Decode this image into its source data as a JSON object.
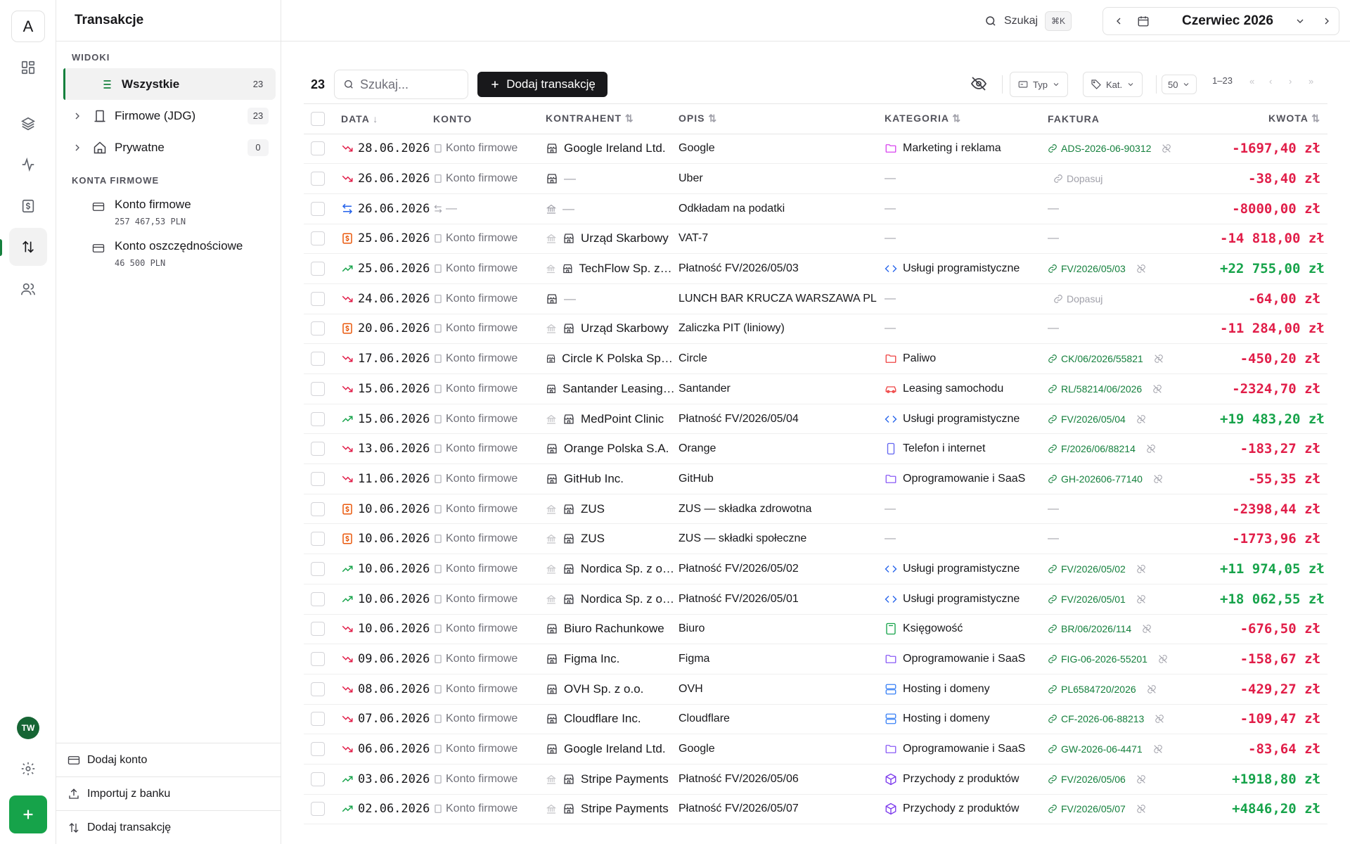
{
  "app": {
    "title": "Transakcje",
    "logo_letter": "A"
  },
  "rail": {
    "avatar_initials": "TW"
  },
  "header": {
    "search_label": "Szukaj",
    "search_shortcut": "⌘K",
    "month": "Czerwiec 2026"
  },
  "sidebar": {
    "views_label": "WIDOKI",
    "views": [
      {
        "label": "Wszystkie",
        "count": "23"
      },
      {
        "label": "Firmowe (JDG)",
        "count": "23"
      },
      {
        "label": "Prywatne",
        "count": "0"
      }
    ],
    "accounts_label": "KONTA FIRMOWE",
    "accounts": [
      {
        "name": "Konto firmowe",
        "balance": "257 467,53 PLN"
      },
      {
        "name": "Konto oszczędnościowe",
        "balance": "46 500 PLN"
      }
    ],
    "actions": [
      "Dodaj konto",
      "Importuj z banku",
      "Dodaj transakcję"
    ]
  },
  "toolbar": {
    "count": "23",
    "search_placeholder": "Szukaj...",
    "add_label": "Dodaj transakcję",
    "filter_type": "Typ",
    "filter_cat": "Kat.",
    "page_size": "50",
    "page_range": "1–23"
  },
  "table": {
    "headers": {
      "date": "DATA",
      "account": "KONTO",
      "counterparty": "KONTRAHENT",
      "desc": "OPIS",
      "category": "KATEGORIA",
      "invoice": "FAKTURA",
      "amount": "KWOTA"
    },
    "rows": [
      {
        "type": "expense",
        "date": "28.06.2026",
        "account": "Konto firmowe",
        "tax": false,
        "cp": "Google Ireland Ltd.",
        "desc": "Google",
        "cat": "Marketing i reklama",
        "caticon": "folder",
        "catcolor": "#d946ef",
        "inv": "ADS-2026-06-90312",
        "amount": "-1697,40 zł",
        "sign": "neg"
      },
      {
        "type": "expense",
        "date": "26.06.2026",
        "account": "Konto firmowe",
        "tax": false,
        "cp": "—",
        "desc": "Uber",
        "cat": "—",
        "caticon": "",
        "catcolor": "",
        "inv": "Dopasuj",
        "invmatch": true,
        "amount": "-38,40 zł",
        "sign": "neg"
      },
      {
        "type": "transfer",
        "date": "26.06.2026",
        "account": "—",
        "tax": false,
        "cp": "—",
        "cpgov": true,
        "desc": "Odkładam na podatki",
        "cat": "—",
        "caticon": "",
        "catcolor": "",
        "inv": "—",
        "amount": "-8000,00 zł",
        "sign": "neg"
      },
      {
        "type": "tax",
        "date": "25.06.2026",
        "account": "Konto firmowe",
        "tax": true,
        "cp": "Urząd Skarbowy",
        "desc": "VAT-7",
        "cat": "—",
        "caticon": "",
        "catcolor": "",
        "inv": "—",
        "amount": "-14 818,00 zł",
        "sign": "neg"
      },
      {
        "type": "income",
        "date": "25.06.2026",
        "account": "Konto firmowe",
        "tax": true,
        "cp": "TechFlow Sp. z o.o.",
        "desc": "Płatność FV/2026/05/03",
        "cat": "Usługi programistyczne",
        "caticon": "code",
        "catcolor": "#2563eb",
        "inv": "FV/2026/05/03",
        "amount": "+22 755,00 zł",
        "sign": "pos"
      },
      {
        "type": "expense",
        "date": "24.06.2026",
        "account": "Konto firmowe",
        "tax": false,
        "cp": "—",
        "desc": "LUNCH BAR KRUCZA WARSZAWA PL",
        "cat": "—",
        "caticon": "",
        "catcolor": "",
        "inv": "Dopasuj",
        "invmatch": true,
        "amount": "-64,00 zł",
        "sign": "neg"
      },
      {
        "type": "tax",
        "date": "20.06.2026",
        "account": "Konto firmowe",
        "tax": true,
        "cp": "Urząd Skarbowy",
        "desc": "Zaliczka PIT (liniowy)",
        "cat": "—",
        "caticon": "",
        "catcolor": "",
        "inv": "—",
        "amount": "-11 284,00 zł",
        "sign": "neg"
      },
      {
        "type": "expense",
        "date": "17.06.2026",
        "account": "Konto firmowe",
        "tax": false,
        "cp": "Circle K Polska Sp. z o.o.",
        "desc": "Circle",
        "cat": "Paliwo",
        "caticon": "folder",
        "catcolor": "#ef4444",
        "inv": "CK/06/2026/55821",
        "amount": "-450,20 zł",
        "sign": "neg"
      },
      {
        "type": "expense",
        "date": "15.06.2026",
        "account": "Konto firmowe",
        "tax": false,
        "cp": "Santander Leasing S.A.",
        "desc": "Santander",
        "cat": "Leasing samochodu",
        "caticon": "car",
        "catcolor": "#ef4444",
        "inv": "RL/58214/06/2026",
        "amount": "-2324,70 zł",
        "sign": "neg"
      },
      {
        "type": "income",
        "date": "15.06.2026",
        "account": "Konto firmowe",
        "tax": true,
        "cp": "MedPoint Clinic",
        "desc": "Płatność FV/2026/05/04",
        "cat": "Usługi programistyczne",
        "caticon": "code",
        "catcolor": "#2563eb",
        "inv": "FV/2026/05/04",
        "amount": "+19 483,20 zł",
        "sign": "pos"
      },
      {
        "type": "expense",
        "date": "13.06.2026",
        "account": "Konto firmowe",
        "tax": false,
        "cp": "Orange Polska S.A.",
        "desc": "Orange",
        "cat": "Telefon i internet",
        "caticon": "phone",
        "catcolor": "#6366f1",
        "inv": "F/2026/06/88214",
        "amount": "-183,27 zł",
        "sign": "neg"
      },
      {
        "type": "expense",
        "date": "11.06.2026",
        "account": "Konto firmowe",
        "tax": false,
        "cp": "GitHub Inc.",
        "desc": "GitHub",
        "cat": "Oprogramowanie i SaaS",
        "caticon": "folder",
        "catcolor": "#8b5cf6",
        "inv": "GH-202606-77140",
        "amount": "-55,35 zł",
        "sign": "neg"
      },
      {
        "type": "tax",
        "date": "10.06.2026",
        "account": "Konto firmowe",
        "tax": true,
        "cp": "ZUS",
        "desc": "ZUS — składka zdrowotna",
        "cat": "—",
        "caticon": "",
        "catcolor": "",
        "inv": "—",
        "amount": "-2398,44 zł",
        "sign": "neg"
      },
      {
        "type": "tax",
        "date": "10.06.2026",
        "account": "Konto firmowe",
        "tax": true,
        "cp": "ZUS",
        "desc": "ZUS — składki społeczne",
        "cat": "—",
        "caticon": "",
        "catcolor": "",
        "inv": "—",
        "amount": "-1773,96 zł",
        "sign": "neg"
      },
      {
        "type": "income",
        "date": "10.06.2026",
        "account": "Konto firmowe",
        "tax": true,
        "cp": "Nordica Sp. z o.o.",
        "desc": "Płatność FV/2026/05/02",
        "cat": "Usługi programistyczne",
        "caticon": "code",
        "catcolor": "#2563eb",
        "inv": "FV/2026/05/02",
        "amount": "+11 974,05 zł",
        "sign": "pos"
      },
      {
        "type": "income",
        "date": "10.06.2026",
        "account": "Konto firmowe",
        "tax": true,
        "cp": "Nordica Sp. z o.o.",
        "desc": "Płatność FV/2026/05/01",
        "cat": "Usługi programistyczne",
        "caticon": "code",
        "catcolor": "#2563eb",
        "inv": "FV/2026/05/01",
        "amount": "+18 062,55 zł",
        "sign": "pos"
      },
      {
        "type": "expense",
        "date": "10.06.2026",
        "account": "Konto firmowe",
        "tax": false,
        "cp": "Biuro Rachunkowe",
        "desc": "Biuro",
        "cat": "Księgowość",
        "caticon": "calc",
        "catcolor": "#16a34a",
        "inv": "BR/06/2026/114",
        "amount": "-676,50 zł",
        "sign": "neg"
      },
      {
        "type": "expense",
        "date": "09.06.2026",
        "account": "Konto firmowe",
        "tax": false,
        "cp": "Figma Inc.",
        "desc": "Figma",
        "cat": "Oprogramowanie i SaaS",
        "caticon": "folder",
        "catcolor": "#8b5cf6",
        "inv": "FIG-06-2026-55201",
        "amount": "-158,67 zł",
        "sign": "neg"
      },
      {
        "type": "expense",
        "date": "08.06.2026",
        "account": "Konto firmowe",
        "tax": false,
        "cp": "OVH Sp. z o.o.",
        "desc": "OVH",
        "cat": "Hosting i domeny",
        "caticon": "server",
        "catcolor": "#3b82f6",
        "inv": "PL6584720/2026",
        "amount": "-429,27 zł",
        "sign": "neg"
      },
      {
        "type": "expense",
        "date": "07.06.2026",
        "account": "Konto firmowe",
        "tax": false,
        "cp": "Cloudflare Inc.",
        "desc": "Cloudflare",
        "cat": "Hosting i domeny",
        "caticon": "server",
        "catcolor": "#3b82f6",
        "inv": "CF-2026-06-88213",
        "amount": "-109,47 zł",
        "sign": "neg"
      },
      {
        "type": "expense",
        "date": "06.06.2026",
        "account": "Konto firmowe",
        "tax": false,
        "cp": "Google Ireland Ltd.",
        "desc": "Google",
        "cat": "Oprogramowanie i SaaS",
        "caticon": "folder",
        "catcolor": "#8b5cf6",
        "inv": "GW-2026-06-4471",
        "amount": "-83,64 zł",
        "sign": "neg"
      },
      {
        "type": "income",
        "date": "03.06.2026",
        "account": "Konto firmowe",
        "tax": true,
        "cp": "Stripe Payments",
        "desc": "Płatność FV/2026/05/06",
        "cat": "Przychody z produktów",
        "caticon": "box",
        "catcolor": "#7c3aed",
        "inv": "FV/2026/05/06",
        "amount": "+1918,80 zł",
        "sign": "pos"
      },
      {
        "type": "income",
        "date": "02.06.2026",
        "account": "Konto firmowe",
        "tax": true,
        "cp": "Stripe Payments",
        "desc": "Płatność FV/2026/05/07",
        "cat": "Przychody z produktów",
        "caticon": "box",
        "catcolor": "#7c3aed",
        "inv": "FV/2026/05/07",
        "amount": "+4846,20 zł",
        "sign": "pos"
      }
    ]
  },
  "colors": {
    "accent": "#15803d",
    "positive": "#16a34a",
    "negative": "#e11d48",
    "tax": "#ea580c",
    "transfer": "#2563eb"
  }
}
